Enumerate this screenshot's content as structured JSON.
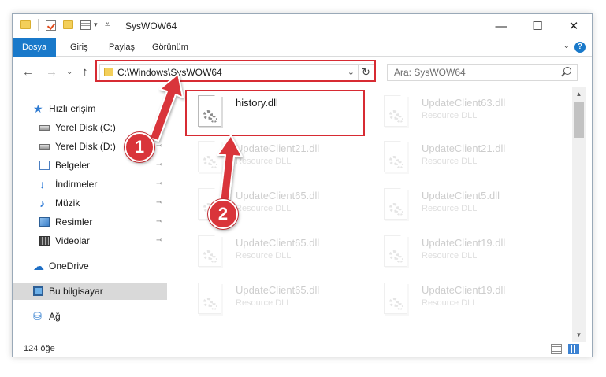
{
  "window": {
    "title": "SysWOW64",
    "minimize_glyph": "—",
    "maximize_glyph": "☐",
    "close_glyph": "✕"
  },
  "ribbon": {
    "tabs": [
      "Dosya",
      "Giriş",
      "Paylaş",
      "Görünüm"
    ],
    "expand_glyph": "⌄",
    "help_glyph": "?"
  },
  "address": {
    "path": "C:\\Windows\\SysWOW64",
    "search_placeholder": "Ara: SysWOW64",
    "back_glyph": "←",
    "forward_glyph": "→",
    "recent_glyph": "⌄",
    "up_glyph": "↑",
    "dropdown_glyph": "⌄",
    "refresh_glyph": "↻"
  },
  "nav": {
    "items": [
      {
        "label": "Hızlı erişim",
        "icon": "quick-access-star-icon"
      },
      {
        "label": "Yerel Disk (C:)",
        "icon": "drive-icon",
        "pinned": true
      },
      {
        "label": "Yerel Disk (D:)",
        "icon": "drive-icon",
        "pinned": true
      },
      {
        "label": "Belgeler",
        "icon": "documents-icon",
        "pinned": true
      },
      {
        "label": "İndirmeler",
        "icon": "downloads-icon",
        "pinned": true
      },
      {
        "label": "Müzik",
        "icon": "music-icon",
        "pinned": true
      },
      {
        "label": "Resimler",
        "icon": "pictures-icon",
        "pinned": true
      },
      {
        "label": "Videolar",
        "icon": "videos-icon",
        "pinned": true
      },
      {
        "label": "OneDrive",
        "icon": "onedrive-icon"
      },
      {
        "label": "Bu bilgisayar",
        "icon": "this-pc-icon",
        "selected": true
      },
      {
        "label": "Ağ",
        "icon": "network-icon"
      }
    ],
    "pin_glyph": "📌"
  },
  "files": {
    "highlighted": {
      "name": "history.dll"
    },
    "faded": [
      {
        "name": "UpdateClient63.dll",
        "desc": "Resource DLL"
      },
      {
        "name": "UpdateClient21.dll",
        "desc": "Resource DLL"
      },
      {
        "name": "UpdateClient21.dll",
        "desc": "Resource DLL"
      },
      {
        "name": "UpdateClient65.dll",
        "desc": "Resource DLL"
      },
      {
        "name": "UpdateClient5.dll",
        "desc": "Resource DLL"
      },
      {
        "name": "UpdateClient65.dll",
        "desc": "Resource DLL"
      },
      {
        "name": "UpdateClient19.dll",
        "desc": "Resource DLL"
      },
      {
        "name": "UpdateClient65.dll",
        "desc": "Resource DLL"
      },
      {
        "name": "UpdateClient19.dll",
        "desc": "Resource DLL"
      }
    ]
  },
  "status": {
    "item_count": "124 öğe"
  },
  "annotations": {
    "badge1": "1",
    "badge2": "2",
    "color": "#d72b33"
  },
  "colors": {
    "accent": "#1979ca",
    "highlight": "#d72b33",
    "selected_bg": "#d9d9d9"
  }
}
